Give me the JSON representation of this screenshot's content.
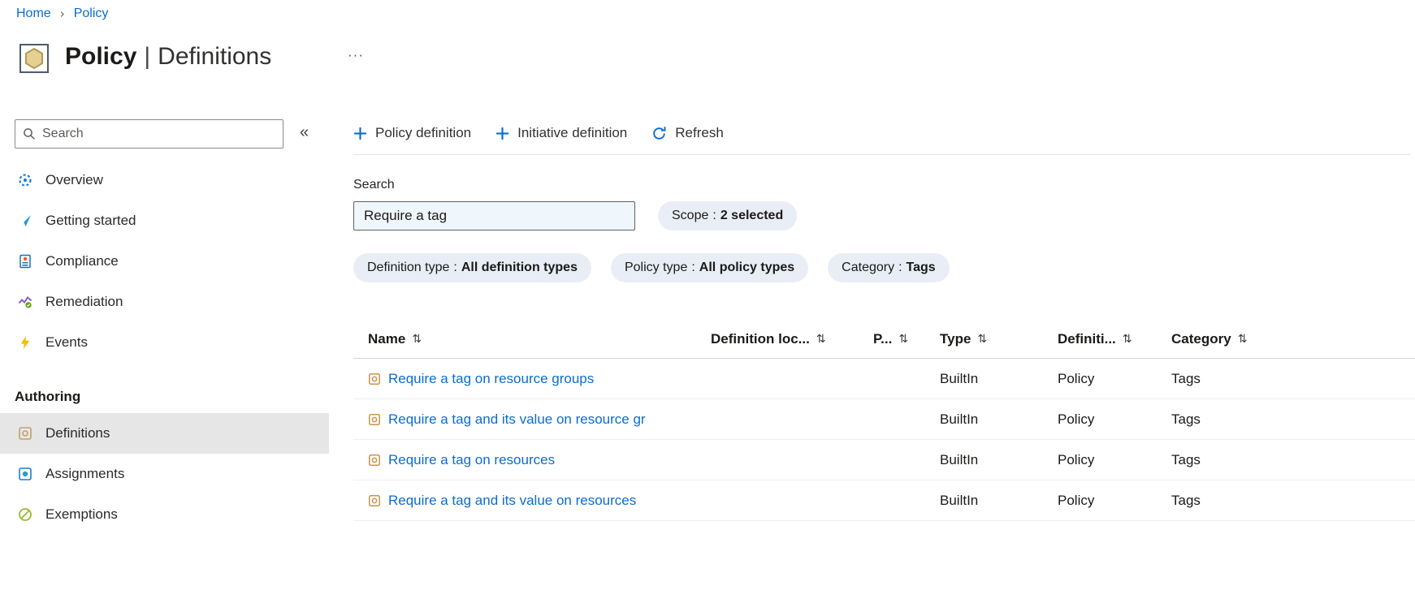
{
  "colors": {
    "link_blue": "#0b6cce",
    "selected_item_gray": "#e6e6e6",
    "pill_background": "#e9eef6",
    "search_input_background": "#eff6fc",
    "text_primary": "#1b1a19",
    "text_secondary": "#605e5c",
    "events_yellow": "#ffb900",
    "policy_icon_tan": "#c8a165"
  },
  "icons": {
    "sort": "⇅",
    "collapse": "«",
    "more": "···",
    "breadcrumb_separator": "›"
  },
  "breadcrumb": {
    "items": [
      {
        "label": "Home"
      },
      {
        "label": "Policy"
      }
    ]
  },
  "header": {
    "title_primary": "Policy",
    "title_separator": "|",
    "title_secondary": "Definitions"
  },
  "sidebar": {
    "search_placeholder": "Search",
    "items": [
      {
        "label": "Overview"
      },
      {
        "label": "Getting started"
      },
      {
        "label": "Compliance"
      },
      {
        "label": "Remediation"
      },
      {
        "label": "Events"
      }
    ],
    "section_header": "Authoring",
    "authoring_items": [
      {
        "label": "Definitions",
        "selected": true
      },
      {
        "label": "Assignments",
        "selected": false
      },
      {
        "label": "Exemptions",
        "selected": false
      }
    ]
  },
  "toolbar": {
    "buttons": [
      {
        "label": "Policy definition"
      },
      {
        "label": "Initiative definition"
      },
      {
        "label": "Refresh"
      }
    ]
  },
  "filters": {
    "search_label": "Search",
    "search_value": "Require a tag",
    "separator": ":",
    "pills": [
      {
        "name": "Scope",
        "value": "2 selected"
      },
      {
        "name": "Definition type",
        "value": "All definition types"
      },
      {
        "name": "Policy type",
        "value": "All policy types"
      },
      {
        "name": "Category",
        "value": "Tags"
      }
    ]
  },
  "table": {
    "columns": [
      {
        "label": "Name"
      },
      {
        "label": "Definition loc..."
      },
      {
        "label": "P..."
      },
      {
        "label": "Type"
      },
      {
        "label": "Definiti..."
      },
      {
        "label": "Category"
      }
    ],
    "rows": [
      {
        "name": "Require a tag on resource groups",
        "type": "BuiltIn",
        "definition_type": "Policy",
        "category": "Tags"
      },
      {
        "name": "Require a tag and its value on resource gr",
        "type": "BuiltIn",
        "definition_type": "Policy",
        "category": "Tags"
      },
      {
        "name": "Require a tag on resources",
        "type": "BuiltIn",
        "definition_type": "Policy",
        "category": "Tags"
      },
      {
        "name": "Require a tag and its value on resources",
        "type": "BuiltIn",
        "definition_type": "Policy",
        "category": "Tags"
      }
    ]
  }
}
